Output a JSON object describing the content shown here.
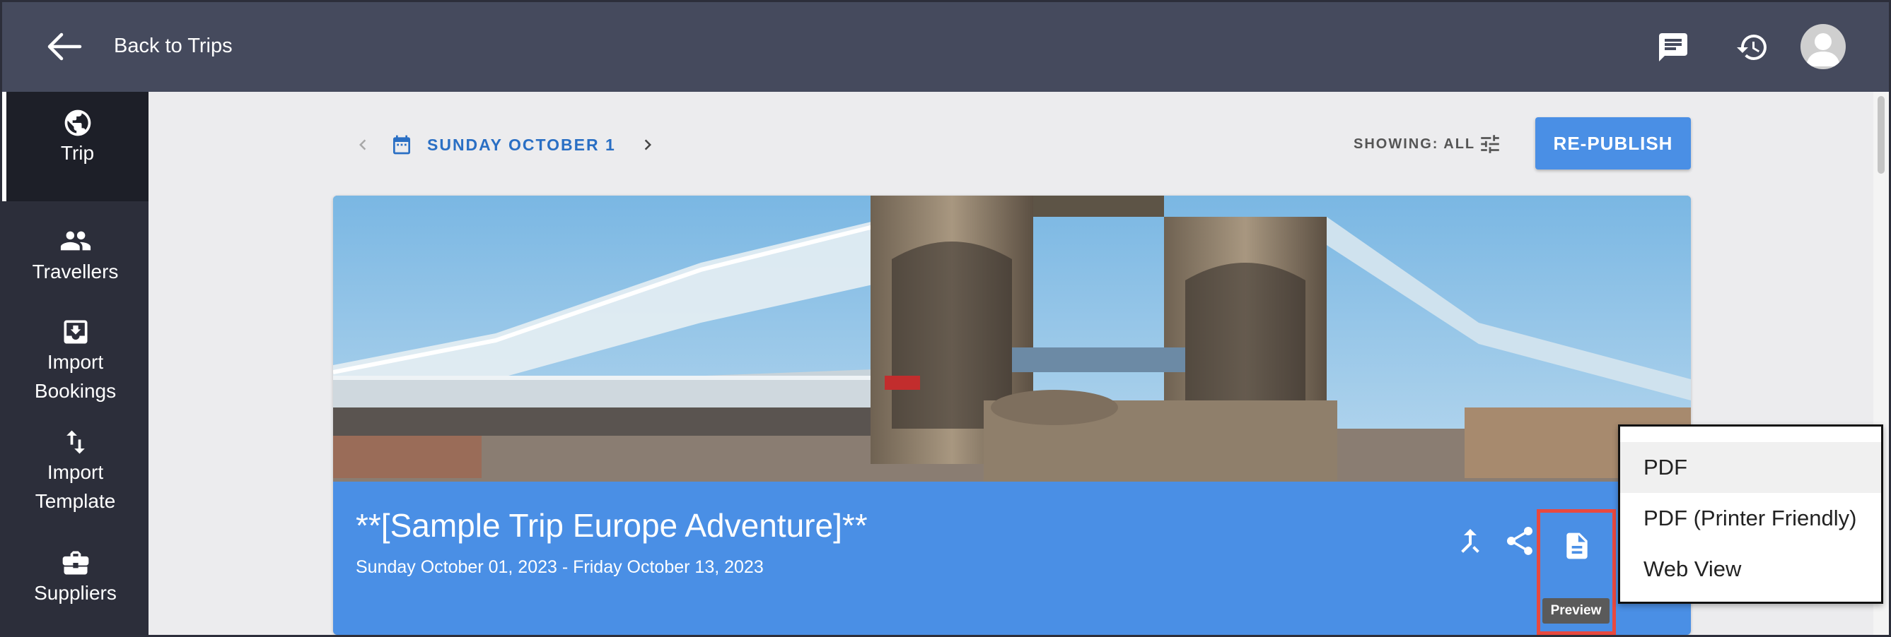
{
  "topbar": {
    "back_label": "Back to Trips",
    "icons": [
      "back-arrow-icon",
      "chat-icon",
      "history-icon",
      "avatar"
    ]
  },
  "sidebar": {
    "items": [
      {
        "label": "Trip",
        "icon": "globe-icon",
        "active": true
      },
      {
        "label": "Travellers",
        "icon": "people-icon"
      },
      {
        "label": "Import Bookings",
        "icon": "import-icon"
      },
      {
        "label": "Import Template",
        "icon": "swap-vert-icon"
      },
      {
        "label": "Suppliers",
        "icon": "briefcase-icon"
      }
    ]
  },
  "date_nav": {
    "label": "SUNDAY OCTOBER 1"
  },
  "toolbar": {
    "showing_label": "SHOWING: ALL",
    "republish_label": "RE-PUBLISH"
  },
  "trip": {
    "title": "**[Sample Trip Europe Adventure]**",
    "dates": "Sunday October 01, 2023 - Friday October 13, 2023"
  },
  "preview": {
    "tooltip": "Preview"
  },
  "menu": {
    "items": [
      "PDF",
      "PDF (Printer Friendly)",
      "Web View"
    ]
  },
  "colors": {
    "accent": "#4a8fe5",
    "topbar": "#454a5d",
    "sidebar": "#2c2e3a",
    "date": "#2a6fc4",
    "highlight": "#e8493f"
  }
}
